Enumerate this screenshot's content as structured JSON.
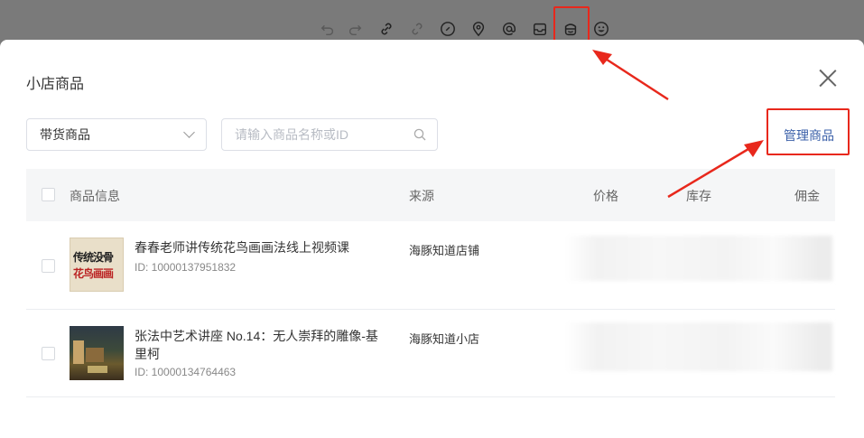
{
  "toolbar": {
    "icons": [
      "undo-icon",
      "redo-icon",
      "link-icon",
      "unlink-icon",
      "link-circle-icon",
      "location-icon",
      "mention-icon",
      "inbox-icon",
      "shop-icon",
      "emoji-icon"
    ]
  },
  "modal": {
    "title": "小店商品",
    "filter": {
      "selected": "带货商品"
    },
    "search": {
      "placeholder": "请输入商品名称或ID"
    },
    "manage_label": "管理商品"
  },
  "table": {
    "columns": [
      "商品信息",
      "来源",
      "价格",
      "库存",
      "佣金"
    ],
    "rows": [
      {
        "name": "春春老师讲传统花鸟画画法线上视频课",
        "id": "ID: 10000137951832",
        "source": "海豚知道店铺",
        "thumb_text": [
          "传统没骨",
          "花鸟画画"
        ]
      },
      {
        "name": "张法中艺术讲座 No.14：无人崇拜的雕像-基里柯",
        "id": "ID: 10000134764463",
        "source": "海豚知道小店",
        "thumb_text": []
      }
    ]
  },
  "colors": {
    "accent": "#3a5fa8",
    "annotation": "#e8281c"
  }
}
